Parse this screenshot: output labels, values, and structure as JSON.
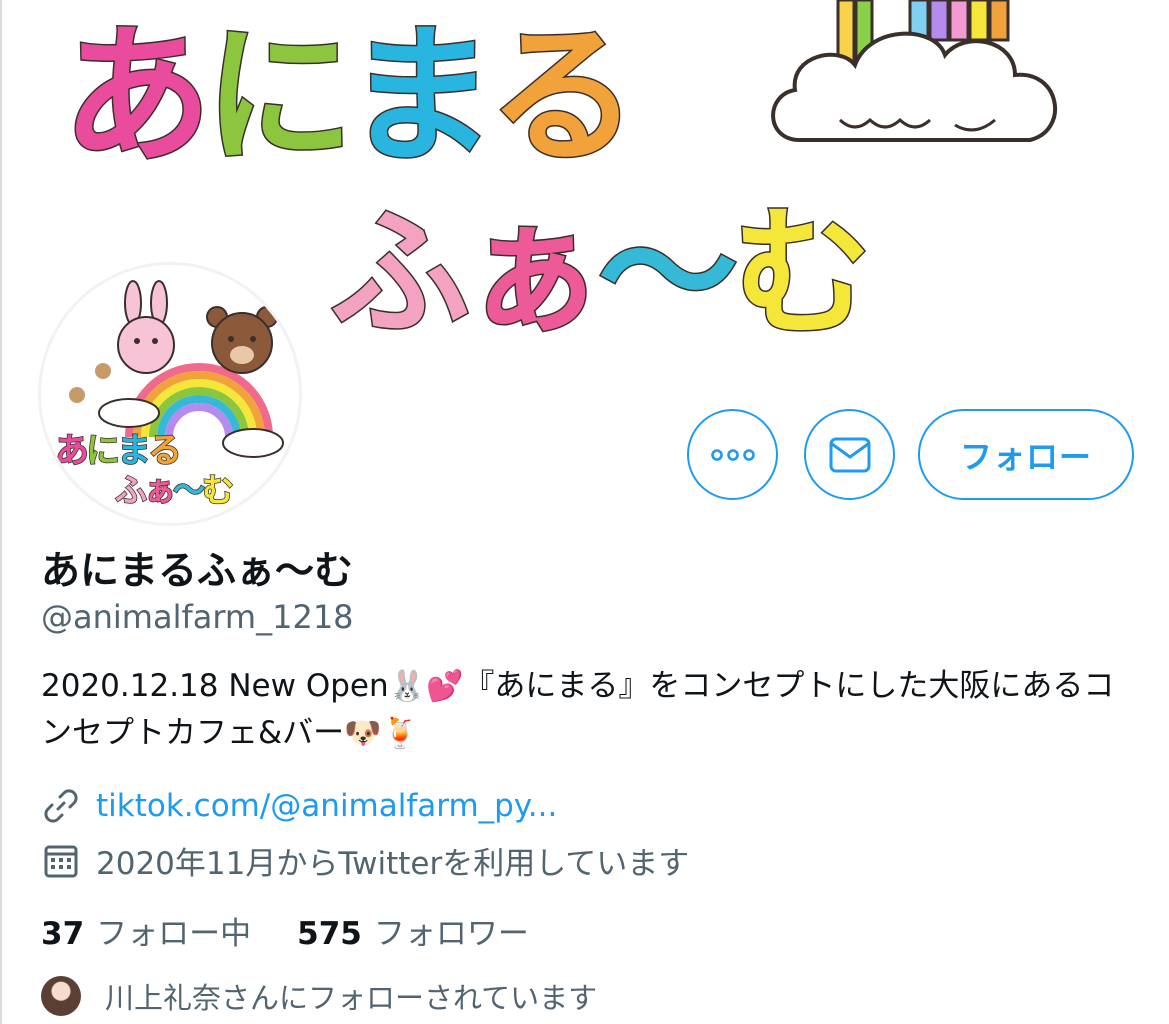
{
  "banner": {
    "title_line1": [
      "あ",
      "に",
      "ま",
      "る"
    ],
    "title_line2": [
      "ふ",
      "ぁ",
      "〜",
      "む"
    ]
  },
  "avatar": {
    "logo_line1": [
      "あ",
      "に",
      "ま",
      "る"
    ],
    "logo_line2": [
      "ふ",
      "ぁ",
      "〜",
      "む"
    ]
  },
  "actions": {
    "follow_label": "フォロー",
    "more_icon": "more-dots-icon",
    "message_icon": "envelope-icon"
  },
  "profile": {
    "name": "あにまるふぁ〜む",
    "handle": "@animalfarm_1218",
    "bio": {
      "part1": "2020.12.18 New Open",
      "emoji1": "🐰",
      "emoji2": "💕",
      "part2": "『あにまる』をコンセプトにした大阪にあるコンセプトカフェ&バー",
      "emoji3": "🐶",
      "emoji4": "🍹"
    },
    "link": "tiktok.com/@animalfarm_py...",
    "joined": "2020年11月からTwitterを利用しています"
  },
  "stats": {
    "following_count": "37",
    "following_label": "フォロー中",
    "followers_count": "575",
    "followers_label": "フォロワー"
  },
  "followed_by": "川上礼奈さんにフォローされています",
  "colors": {
    "accent": "#1d9bf0",
    "secondary_text": "#536471",
    "primary_text": "#0f1419"
  }
}
